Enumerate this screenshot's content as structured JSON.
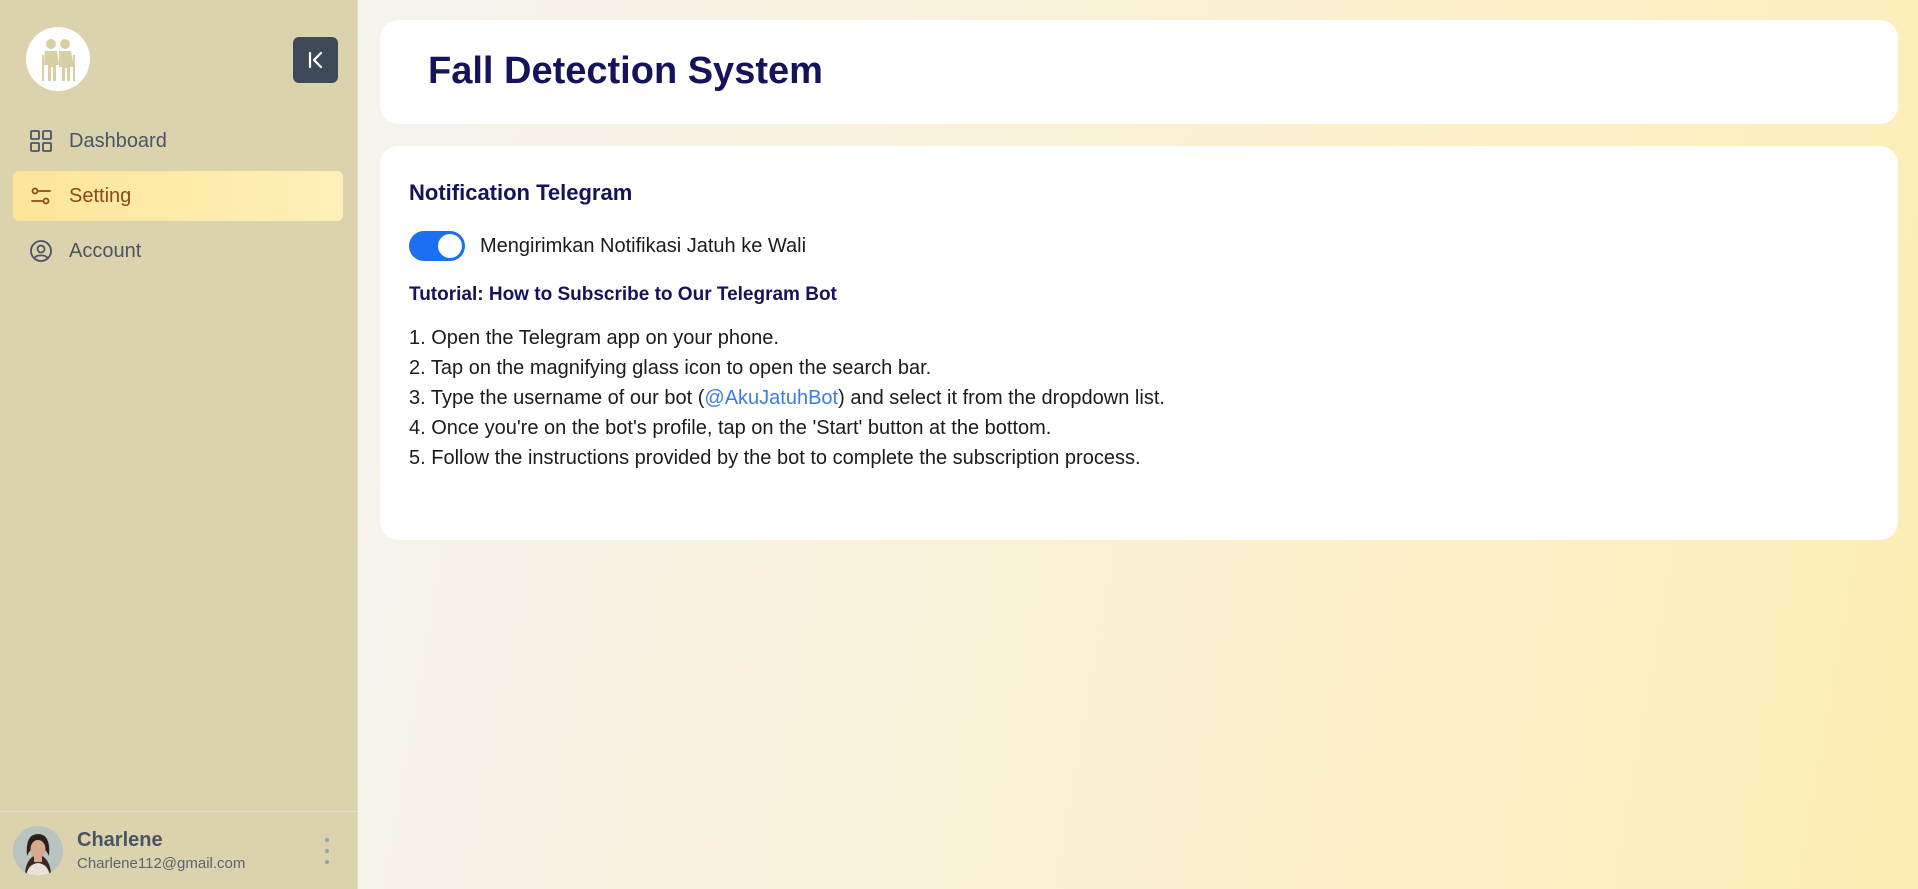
{
  "sidebar": {
    "logo_icon": "elderly-couple-icon",
    "collapse_icon": "collapse-left-icon",
    "items": [
      {
        "label": "Dashboard",
        "icon": "dashboard-grid-icon",
        "active": false
      },
      {
        "label": "Setting",
        "icon": "sliders-icon",
        "active": true
      },
      {
        "label": "Account",
        "icon": "user-circle-icon",
        "active": false
      }
    ],
    "user": {
      "name": "Charlene",
      "email": "Charlene112@gmail.com"
    }
  },
  "header": {
    "title": "Fall Detection System"
  },
  "settings": {
    "section_title": "Notification Telegram",
    "toggle_label": "Mengirimkan Notifikasi Jatuh ke Wali",
    "toggle_on": true,
    "tutorial_title": "Tutorial: How to Subscribe to Our Telegram Bot",
    "steps": [
      {
        "number": "1.",
        "text": "Open the Telegram app on your phone."
      },
      {
        "number": "2.",
        "text": "Tap on the magnifying glass icon to open the search bar."
      },
      {
        "number": "3.",
        "before": "Type the username of our bot (",
        "link": "@AkuJatuhBot",
        "after": ") and select it from the dropdown list."
      },
      {
        "number": "4.",
        "text": "Once you're on the bot's profile, tap on the 'Start' button at the bottom."
      },
      {
        "number": "5.",
        "text": "Follow the instructions provided by the bot to complete the subscription process."
      }
    ]
  },
  "colors": {
    "sidebar_bg": "#dbd3ae",
    "active_item_bg": "#fde69a",
    "title_navy": "#15135a",
    "toggle_blue": "#1d6ff2",
    "link_blue": "#3b7de0"
  }
}
